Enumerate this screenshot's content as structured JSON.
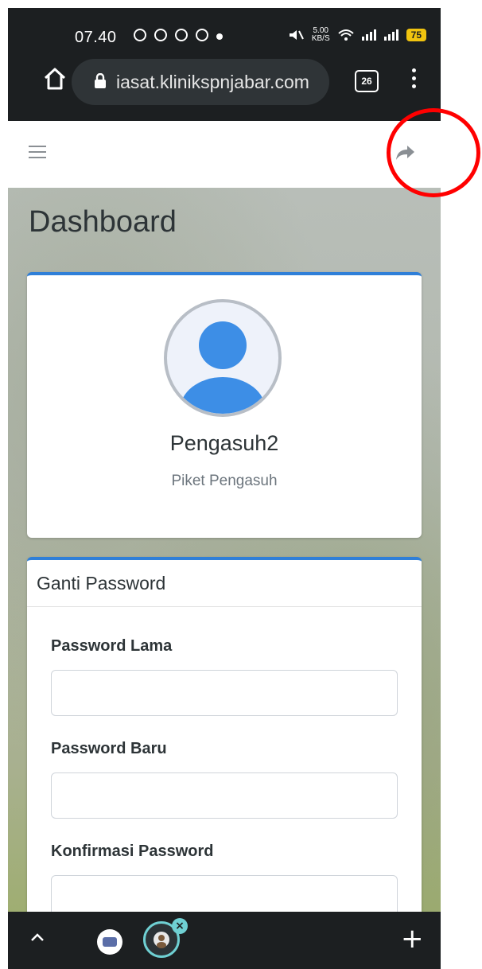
{
  "status_bar": {
    "time": "07.40",
    "network_speed_value": "5.00",
    "network_speed_unit": "KB/S",
    "battery": "75"
  },
  "browser": {
    "url": "iasat.klinikspnjabar.com",
    "tab_count": "26",
    "icons": {
      "home": "home-icon",
      "lock": "lock-icon",
      "menu": "more-vert-icon"
    }
  },
  "navbar": {
    "icons": {
      "menu": "hamburger-icon",
      "logout": "logout-icon"
    }
  },
  "page": {
    "title": "Dashboard"
  },
  "profile": {
    "name": "Pengasuh2",
    "role": "Piket Pengasuh"
  },
  "change_password": {
    "header": "Ganti Password",
    "fields": [
      {
        "label": "Password Lama",
        "value": "",
        "placeholder": ""
      },
      {
        "label": "Password Baru",
        "value": "",
        "placeholder": ""
      },
      {
        "label": "Konfirmasi Password",
        "value": "",
        "placeholder": ""
      }
    ]
  },
  "bottom_toolbar": {
    "icons": {
      "collapse": "chevron-up-icon",
      "new_tab": "plus-icon",
      "close": "close-icon"
    }
  },
  "colors": {
    "accent": "#2f7fd8",
    "annotation": "#ff0000",
    "browser_chrome": "#1c1f21"
  }
}
